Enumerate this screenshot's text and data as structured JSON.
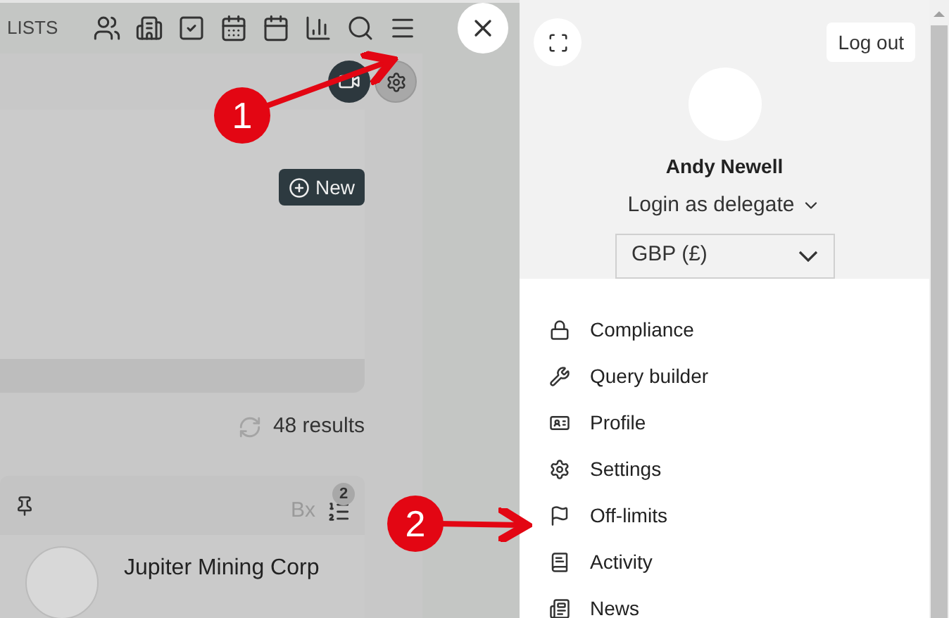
{
  "header": {
    "label": "LISTS"
  },
  "toolbar": {
    "new_button": "New"
  },
  "results": {
    "count": "48 results"
  },
  "record_card": {
    "box_label": "Bx",
    "badge": "2",
    "title": "Jupiter Mining Corp"
  },
  "annotations": [
    {
      "label": "1"
    },
    {
      "label": "2"
    }
  ],
  "user_panel": {
    "logout": "Log out",
    "name": "Andy Newell",
    "delegate": "Login as delegate",
    "currency": "GBP (£)"
  },
  "menu": [
    {
      "label": "Compliance"
    },
    {
      "label": "Query builder"
    },
    {
      "label": "Profile"
    },
    {
      "label": "Settings"
    },
    {
      "label": "Off-limits"
    },
    {
      "label": "Activity"
    },
    {
      "label": "News"
    }
  ]
}
